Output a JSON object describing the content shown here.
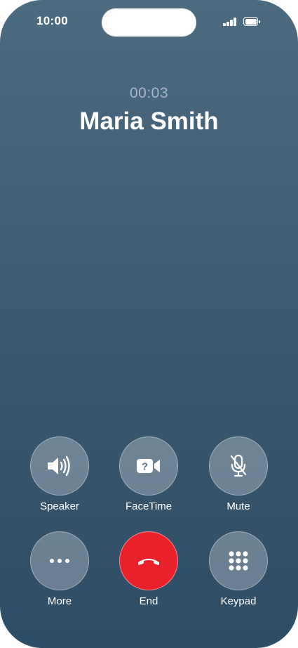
{
  "status_bar": {
    "time": "10:00"
  },
  "call": {
    "duration": "00:03",
    "contact_name": "Maria Smith"
  },
  "controls": [
    {
      "label": "Speaker",
      "icon": "speaker-icon"
    },
    {
      "label": "FaceTime",
      "icon": "facetime-icon"
    },
    {
      "label": "Mute",
      "icon": "microphone-muted-icon"
    },
    {
      "label": "More",
      "icon": "ellipsis-icon"
    },
    {
      "label": "End",
      "icon": "phone-hangup-icon"
    },
    {
      "label": "Keypad",
      "icon": "keypad-icon"
    }
  ],
  "colors": {
    "end_button": "#e8212b",
    "background_top": "#4c6b81",
    "background_bottom": "#2e4d66"
  }
}
